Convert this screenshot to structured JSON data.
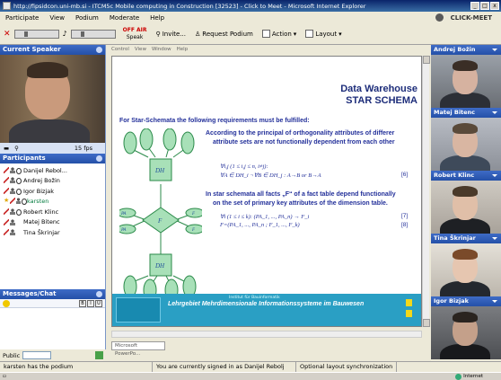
{
  "window": {
    "title": "http://fipsidcon.uni-mb.si - ITCM5c Mobile computing in Construction [32523] - Click to Meet - Microsoft Internet Explorer"
  },
  "menu": {
    "items": [
      "Participate",
      "View",
      "Podium",
      "Moderate",
      "Help"
    ],
    "brand": "CLICK-MEET"
  },
  "toolbar": {
    "off_air": "OFF AIR",
    "speak": "Speak",
    "invite": "Invite...",
    "request_podium": "Request Podium",
    "action": "Action",
    "layout": "Layout"
  },
  "current_speaker": {
    "title": "Current Speaker",
    "fps": "15 fps"
  },
  "participants": {
    "title": "Participants",
    "list": [
      {
        "name": "Danijel Rebol..."
      },
      {
        "name": "Andrej Božin"
      },
      {
        "name": "Igor Bizjak"
      },
      {
        "name": "karsten"
      },
      {
        "name": "Robert Klinc"
      },
      {
        "name": "Matej Bitenc"
      },
      {
        "name": "Tina Škrinjar"
      }
    ]
  },
  "messages": {
    "title": "Messages/Chat",
    "scope": "Public"
  },
  "slide": {
    "inner_menu": [
      "Control",
      "View",
      "Window",
      "Help"
    ],
    "title_line1": "Data Warehouse",
    "title_line2": "STAR SCHEMA",
    "intro": "For Star-Schemata the following requirements must be fulfilled:",
    "para1_line1": "According to the principal of orthogonality attributes of differer",
    "para1_line2": "attribute sets are not functionally dependent from each other",
    "f1a": "∀i,j (1 ≤ i,j ≤ n, i≠j):",
    "f1b": "∀A ∈ DH_i ¬∀B ∈ DH_j : A→B or B→A",
    "ref6": "[6]",
    "para2_line1": "In star schemata all facts „F“ of a fact table depend functionally",
    "para2_line2": "on the set of primary key attributes of the dimension table.",
    "f2": "∀i (1 ≤ i ≤ k): (PA_1, ..., PA_n) → F_i",
    "ref7": "[7]",
    "f3": "F=(PA_1, ..., PA_n ; F_1, ..., F_k)",
    "ref8": "[8]",
    "footer_main": "Lehrgebiet Mehrdimensionale Informationssysteme im Bauwesen",
    "footer_small": "Institut für Bauinformatik",
    "diagram": {
      "dh": "DH",
      "f": "F",
      "pa": "PA",
      "fi": "F"
    },
    "tab": "Microsoft PowerPo..."
  },
  "videos": [
    {
      "name": "Andrej Božin"
    },
    {
      "name": "Matej Bitenc"
    },
    {
      "name": "Robert Klinc"
    },
    {
      "name": "Tina Škrinjar"
    },
    {
      "name": "Igor Bizjak"
    }
  ],
  "status": {
    "podium": "karsten has the podium",
    "signed_in": "You are currently signed in as Danijel Rebolj",
    "sync": "Optional layout synchronization",
    "zone": "Internet"
  }
}
